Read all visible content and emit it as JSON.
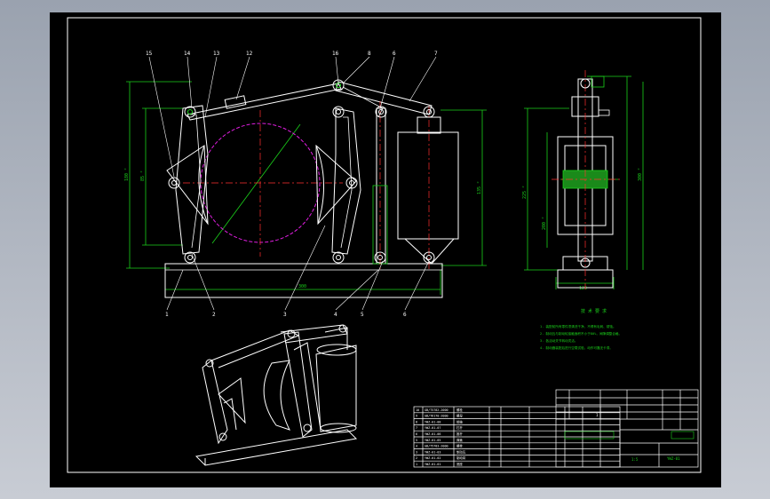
{
  "front_view": {
    "callouts": [
      "15",
      "14",
      "13",
      "12",
      "16",
      "8",
      "6",
      "7",
      "1",
      "2",
      "3",
      "4",
      "5",
      "6"
    ],
    "dims": {
      "overall_height": "180 °",
      "inner_height": "85 °",
      "base_width": "300",
      "right_height": "135 °"
    }
  },
  "side_view": {
    "dims": {
      "left": "225 °",
      "mid": "200 °",
      "right": "300 °",
      "bottom": "120"
    }
  },
  "notes": {
    "title": "技 术 要 求",
    "lines": [
      "1. 装配前所有零件须清洗干净，不得有毛刺、锈蚀。",
      "2. 制动瓦与制动轮接触面积不小于80%，间隙调整合格。",
      "3. 各活动关节转动灵活。",
      "4. 制动器装配后进行空载试验，动作可靠无卡滞。"
    ]
  },
  "title_block": {
    "drawing_no": "YWZ-01",
    "scale": "1:5",
    "sheet": "1"
  },
  "parts_list": {
    "rows": [
      [
        "10",
        "GB/T5782-2000",
        "螺栓"
      ],
      [
        "9",
        "GB/T6170-2000",
        "螺母"
      ],
      [
        "8",
        "YWZ-01-08",
        "销轴"
      ],
      [
        "7",
        "YWZ-01-07",
        "杠杆"
      ],
      [
        "6",
        "YWZ-01-06",
        "推杆"
      ],
      [
        "5",
        "YWZ-01-05",
        "弹簧"
      ],
      [
        "4",
        "GB/T5783-2000",
        "螺栓"
      ],
      [
        "3",
        "YWZ-01-03",
        "制动瓦"
      ],
      [
        "2",
        "YWZ-01-02",
        "制动臂"
      ],
      [
        "1",
        "YWZ-01-01",
        "底座"
      ]
    ]
  }
}
